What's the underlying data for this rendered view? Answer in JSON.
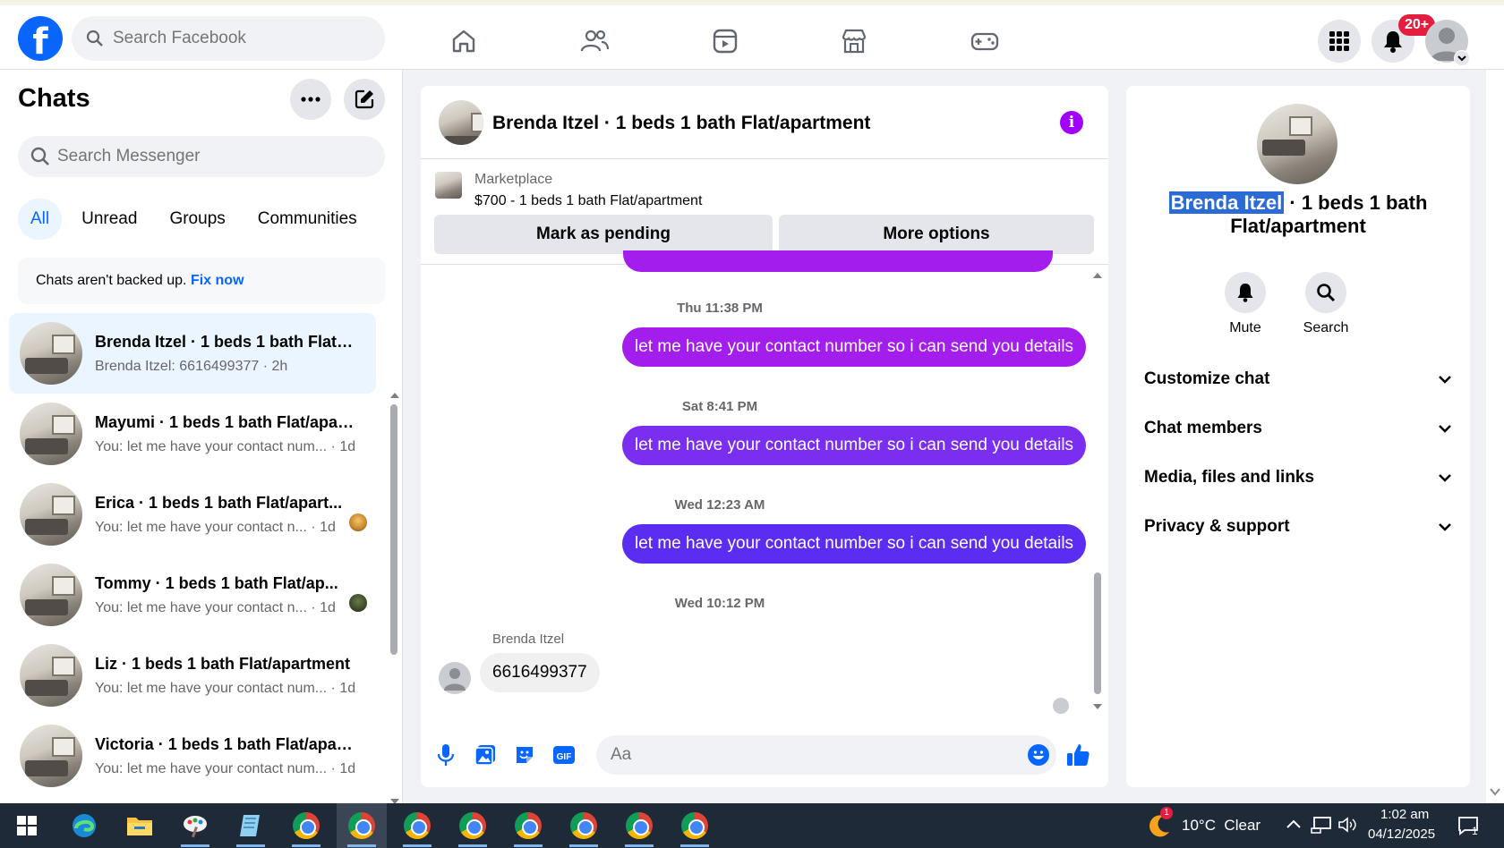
{
  "topbar": {
    "search_placeholder": "Search Facebook",
    "notif_badge": "20+",
    "logo_letter": "f"
  },
  "left": {
    "title": "Chats",
    "search_placeholder": "Search Messenger",
    "filters": [
      "All",
      "Unread",
      "Groups",
      "Communities"
    ],
    "backup_text": "Chats aren't backed up.",
    "backup_link": "Fix now",
    "chats": [
      {
        "name": "Brenda Itzel · 1 beds 1 bath Flat/...",
        "preview": "Brenda Itzel: 6616499377 · 2h"
      },
      {
        "name": "Mayumi · 1 beds 1 bath Flat/apar...",
        "preview": "You: let me have your contact num... · 1d"
      },
      {
        "name": "Erica · 1 beds 1 bath Flat/apart...",
        "preview": "You: let me have your contact n... · 1d"
      },
      {
        "name": "Tommy · 1 beds 1 bath Flat/ap...",
        "preview": "You: let me have your contact n... · 1d"
      },
      {
        "name": "Liz · 1 beds 1 bath Flat/apartment",
        "preview": "You: let me have your contact num... · 1d"
      },
      {
        "name": "Victoria · 1 beds 1 bath Flat/apar...",
        "preview": "You: let me have your contact num... · 1d"
      }
    ]
  },
  "conversation": {
    "title": "Brenda Itzel · 1 beds 1 bath Flat/apartment",
    "marketplace_label": "Marketplace",
    "marketplace_item": "$700 - 1 beds 1 bath Flat/apartment",
    "mark_pending": "Mark as pending",
    "more_options": "More options",
    "messages": [
      {
        "time": "Thu 11:38 PM",
        "text": "let me have your contact number so i can send you details"
      },
      {
        "time": "Sat 8:41 PM",
        "text": "let me have your contact number so i can send you details"
      },
      {
        "time": "Wed 12:23 AM",
        "text": "let me have your contact number so i can send you details"
      }
    ],
    "last_time": "Wed 10:12 PM",
    "received_sender": "Brenda Itzel",
    "received_text": "6616499377",
    "composer_placeholder": "Aa",
    "colors": {
      "bubble_1": "#a31dec",
      "bubble_2": "#7a2ff0",
      "bubble_3": "#5b2df3"
    }
  },
  "right": {
    "name_highlight": "Brenda Itzel",
    "name_rest": " · 1 beds 1 bath Flat/apartment",
    "mute": "Mute",
    "search": "Search",
    "sections": [
      "Customize chat",
      "Chat members",
      "Media, files and links",
      "Privacy & support"
    ]
  },
  "taskbar": {
    "weather": "10°C  Clear",
    "time": "1:02 am",
    "date": "04/12/2025",
    "weather_badge": "1",
    "notif_count": "1"
  }
}
